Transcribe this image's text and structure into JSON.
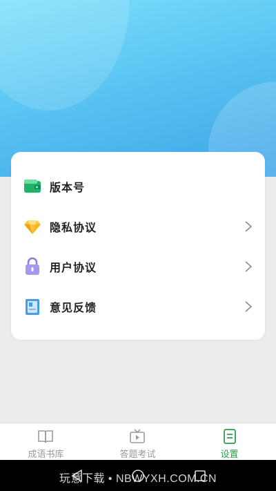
{
  "settings": {
    "items": [
      {
        "label": "版本号",
        "icon": "wallet-icon",
        "has_chevron": false
      },
      {
        "label": "隐私协议",
        "icon": "diamond-icon",
        "has_chevron": true
      },
      {
        "label": "用户协议",
        "icon": "lock-icon",
        "has_chevron": true
      },
      {
        "label": "意见反馈",
        "icon": "notebook-icon",
        "has_chevron": true
      }
    ]
  },
  "tabbar": {
    "tabs": [
      {
        "label": "成语书库",
        "icon": "book-icon",
        "active": false
      },
      {
        "label": "答题考试",
        "icon": "tv-icon",
        "active": false
      },
      {
        "label": "设置",
        "icon": "document-icon",
        "active": true
      }
    ]
  },
  "watermark": "玩意下载 • NBWYXH.COM.CN",
  "colors": {
    "hero_light": "#7fe0fb",
    "hero_dark": "#3ea3e6",
    "accent_green": "#2b9e4b",
    "inactive_gray": "#9a9a9a"
  }
}
